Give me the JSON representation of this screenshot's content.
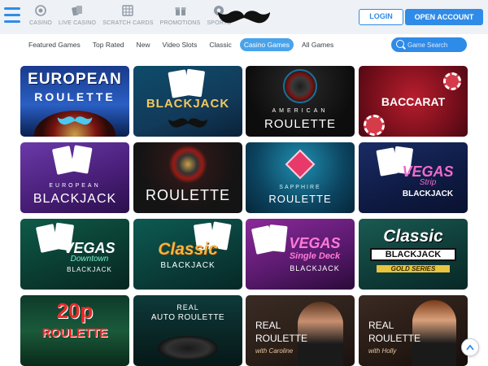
{
  "header": {
    "nav": [
      {
        "label": "CASINO",
        "icon": "casino-chip-icon"
      },
      {
        "label": "LIVE CASINO",
        "icon": "cards-icon"
      },
      {
        "label": "SCRATCH CARDS",
        "icon": "scratch-card-icon"
      },
      {
        "label": "PROMOTIONS",
        "icon": "gift-icon"
      },
      {
        "label": "SPORTS",
        "icon": "football-icon"
      }
    ],
    "login_label": "LOGIN",
    "open_account_label": "OPEN ACCOUNT",
    "logo": "moustache-logo"
  },
  "filters": {
    "tabs": [
      "Featured Games",
      "Top Rated",
      "New",
      "Video Slots",
      "Classic",
      "Casino Games",
      "All Games"
    ],
    "active": "Casino Games",
    "search_placeholder": "Game Search"
  },
  "games": [
    {
      "l1": "EUROPEAN",
      "l2": "ROULETTE",
      "l3": ""
    },
    {
      "l1": "BLACKJACK",
      "l2": "",
      "l3": ""
    },
    {
      "l1": "AMERICAN",
      "l2": "ROULETTE",
      "l3": ""
    },
    {
      "l1": "BACCARAT",
      "l2": "",
      "l3": ""
    },
    {
      "l1": "EUROPEAN",
      "l2": "BLACKJACK",
      "l3": ""
    },
    {
      "l1": "ROULETTE",
      "l2": "",
      "l3": ""
    },
    {
      "l1": "SAPPHIRE",
      "l2": "ROULETTE",
      "l3": ""
    },
    {
      "l1": "VEGAS",
      "l2": "Strip",
      "l3": "BLACKJACK"
    },
    {
      "l1": "VEGAS",
      "l2": "Downtown",
      "l3": "BLACKJACK"
    },
    {
      "l1": "Classic",
      "l2": "BLACKJACK",
      "l3": ""
    },
    {
      "l1": "VEGAS",
      "l2": "Single Deck",
      "l3": "BLACKJACK"
    },
    {
      "l1": "Classic",
      "l2": "BLACKJACK",
      "l3": "GOLD SERIES"
    },
    {
      "l1": "20p",
      "l2": "ROULETTE",
      "l3": ""
    },
    {
      "l1": "REAL",
      "l2": "AUTO ROULETTE",
      "l3": ""
    },
    {
      "l1": "REAL",
      "l2": "ROULETTE",
      "l3": "with Caroline"
    },
    {
      "l1": "REAL",
      "l2": "ROULETTE",
      "l3": "with Holly"
    }
  ],
  "colors": {
    "accent": "#2f8be8",
    "active_chip": "#4aa3ea",
    "header_bg": "#eef1f5"
  }
}
